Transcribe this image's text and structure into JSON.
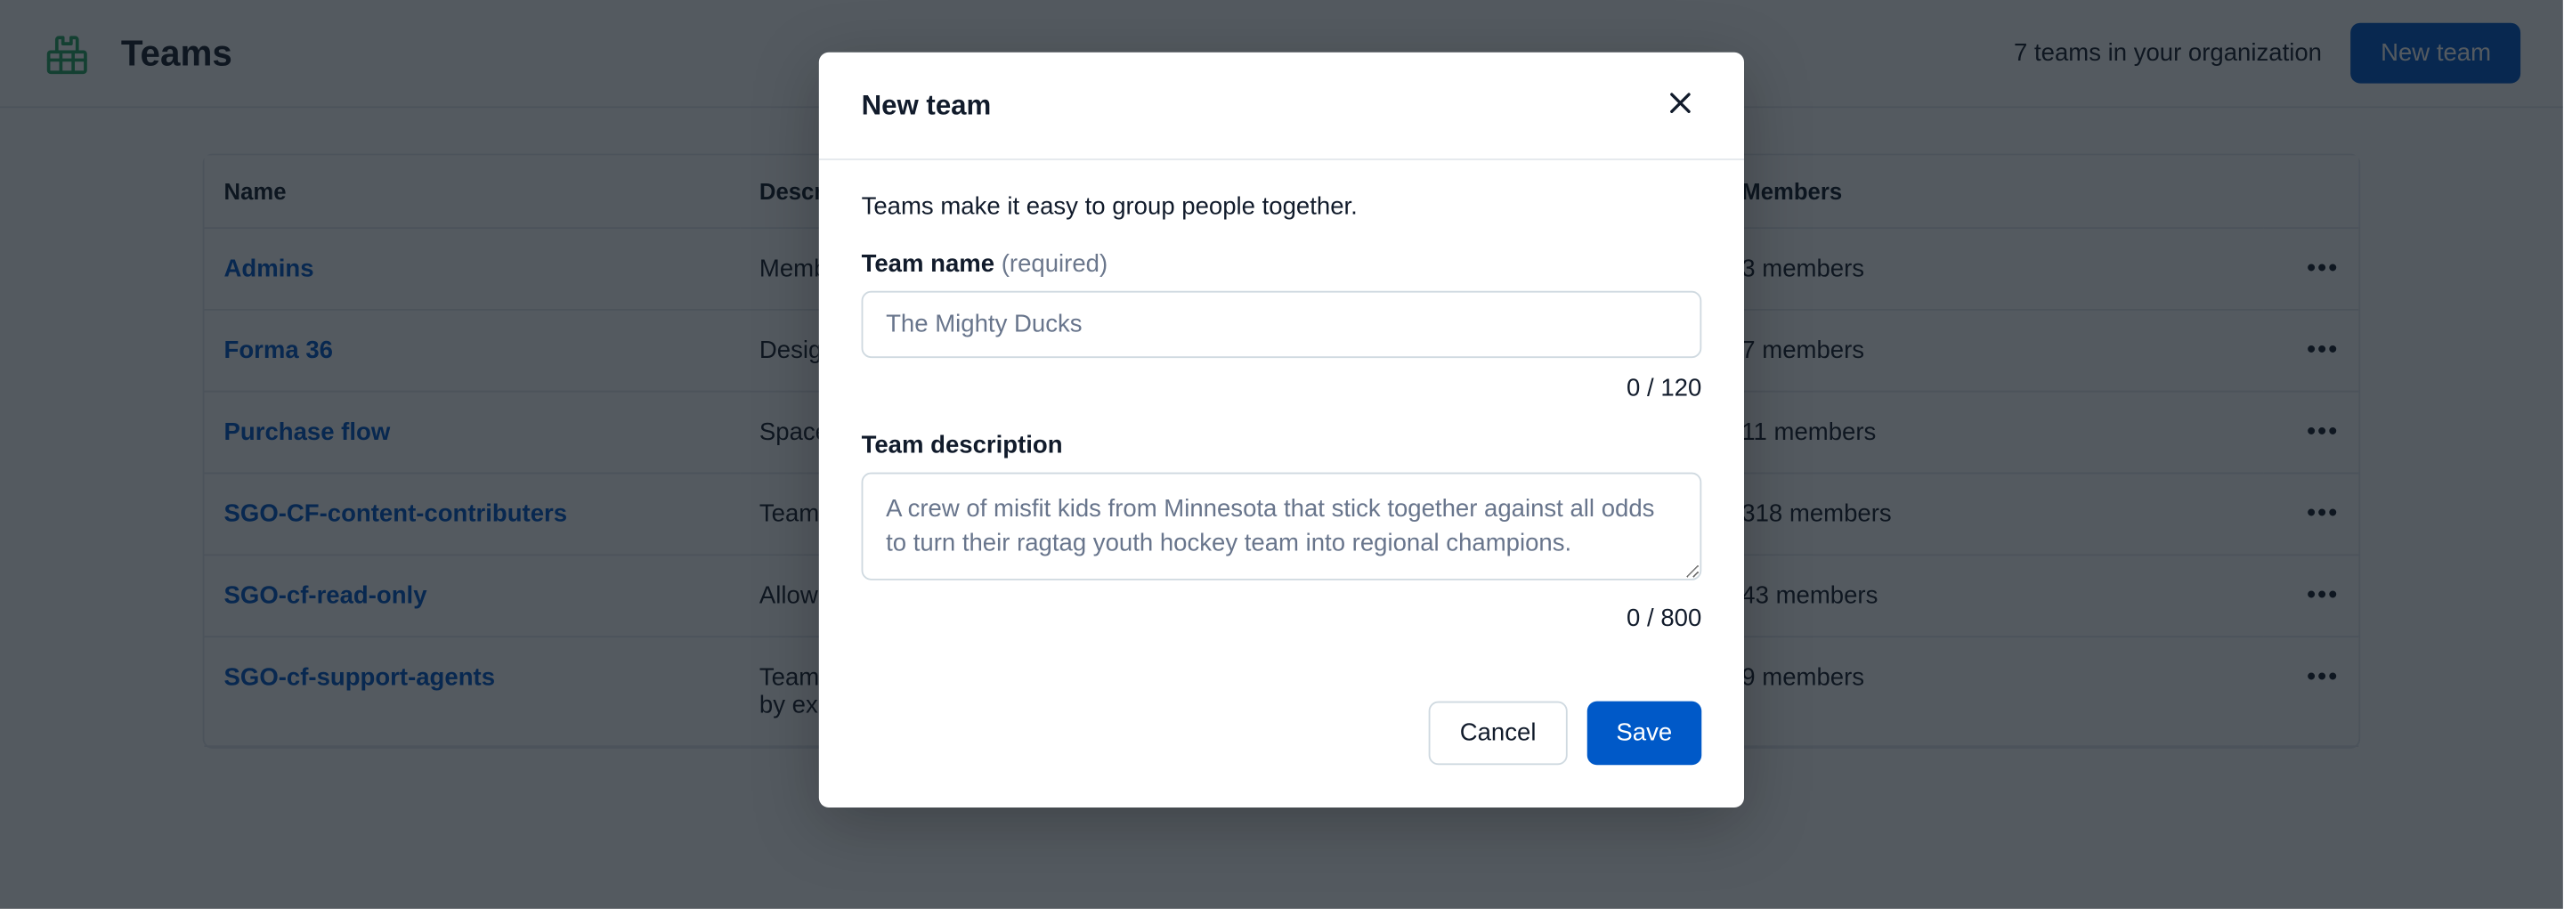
{
  "header": {
    "title": "Teams",
    "team_count_text": "7 teams in your organization",
    "new_team_button": "New team"
  },
  "colors": {
    "primary": "#0059C8",
    "icon_green": "#28a764"
  },
  "table": {
    "columns": {
      "name": "Name",
      "description": "Description",
      "members": "Members"
    },
    "rows": [
      {
        "name": "Admins",
        "description": "Memb",
        "members": "3 members"
      },
      {
        "name": "Forma 36",
        "description": "Design system cowboys. Come to us for help or an introd",
        "members": "7 members"
      },
      {
        "name": "Purchase flow",
        "description": "Space used for developing and testing the purchase flow experi",
        "members": "11 members"
      },
      {
        "name": "SGO-CF-content-contributers",
        "description": "Team",
        "members": "318 members"
      },
      {
        "name": "SGO-cf-read-only",
        "description": "Allow",
        "members": "43 members"
      },
      {
        "name": "SGO-cf-support-agents",
        "description": "Team for support agents. They can create support articles which can then be published by experts.",
        "members": "9 members"
      }
    ]
  },
  "modal": {
    "title": "New team",
    "intro": "Teams make it easy to group people together.",
    "name_label": "Team name",
    "name_required": " (required)",
    "name_placeholder": "The Mighty Ducks",
    "name_value": "",
    "name_count": "0 / 120",
    "desc_label": "Team description",
    "desc_placeholder": "A crew of misfit kids from Minnesota that stick together against all odds to turn their ragtag youth hockey team into regional champions.",
    "desc_value": "",
    "desc_count": "0 / 800",
    "cancel": "Cancel",
    "save": "Save"
  }
}
